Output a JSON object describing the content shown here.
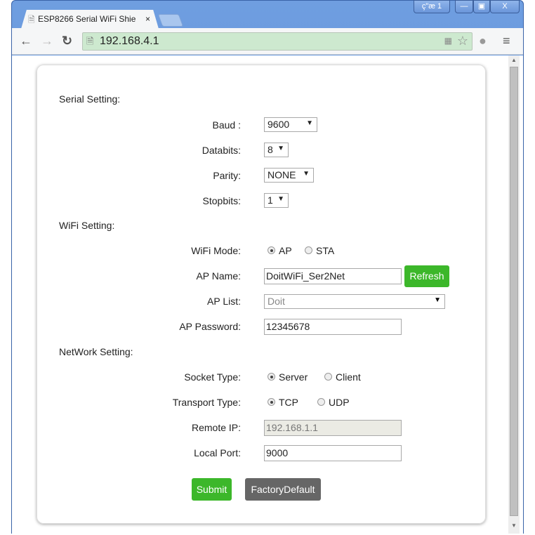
{
  "browser": {
    "tab_title": "ESP8266 Serial WiFi Shie",
    "url": "192.168.4.1",
    "ime_label": "ç\"æ 1"
  },
  "sections": {
    "serial": "Serial Setting:",
    "wifi": "WiFi Setting:",
    "network": "NetWork Setting:"
  },
  "serial": {
    "baud": {
      "label": "Baud :",
      "value": "9600"
    },
    "databits": {
      "label": "Databits:",
      "value": "8"
    },
    "parity": {
      "label": "Parity:",
      "value": "NONE"
    },
    "stopbits": {
      "label": "Stopbits:",
      "value": "1"
    }
  },
  "wifi": {
    "mode": {
      "label": "WiFi Mode:",
      "options": [
        "AP",
        "STA"
      ],
      "selected": "AP"
    },
    "ap_name": {
      "label": "AP Name:",
      "value": "DoitWiFi_Ser2Net"
    },
    "refresh_label": "Refresh",
    "ap_list": {
      "label": "AP List:",
      "value": "Doit"
    },
    "ap_password": {
      "label": "AP Password:",
      "value": "12345678"
    }
  },
  "network": {
    "socket_type": {
      "label": "Socket Type:",
      "options": [
        "Server",
        "Client"
      ],
      "selected": "Server"
    },
    "transport_type": {
      "label": "Transport Type:",
      "options": [
        "TCP",
        "UDP"
      ],
      "selected": "TCP"
    },
    "remote_ip": {
      "label": "Remote IP:",
      "value": "192.168.1.1"
    },
    "local_port": {
      "label": "Local Port:",
      "value": "9000"
    }
  },
  "buttons": {
    "submit": "Submit",
    "factory_default": "FactoryDefault"
  },
  "colors": {
    "green": "#3cb72a",
    "gray": "#666666"
  }
}
